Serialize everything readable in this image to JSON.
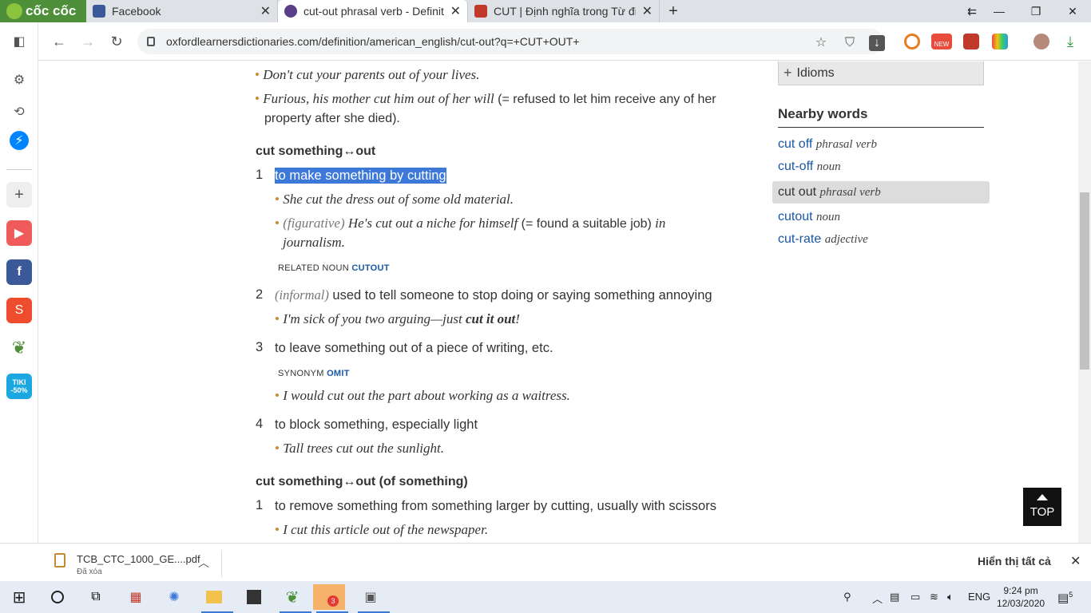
{
  "browser": {
    "logo_text": "cốc cốc",
    "tabs": [
      {
        "title": "Facebook",
        "icon": "facebook-icon",
        "color": "#3b5998"
      },
      {
        "title": "cut-out phrasal verb - Definiti",
        "icon": "oxford-icon",
        "color": "#1a2a6c",
        "active": true
      },
      {
        "title": "CUT | Định nghĩa trong Từ điể",
        "icon": "cambridge-icon",
        "color": "#c0392b"
      }
    ],
    "new_tab": "+",
    "url": "oxfordlearnersdictionaries.com/definition/american_english/cut-out?q=+CUT+OUT+"
  },
  "sidebar": {
    "items": [
      "sidebar-toggle-icon",
      "settings-icon",
      "history-icon",
      "messenger-icon",
      "add-icon",
      "youtube-icon",
      "facebook-icon",
      "shopee-icon",
      "coccoc-icon",
      "tiki-icon"
    ],
    "tiki_text": "TIKI -50%"
  },
  "content": {
    "examples_top": [
      {
        "text": "Don't cut your parents out of your lives."
      },
      {
        "text_italic": "Furious, his mother cut him out of her will",
        "gloss": " (= refused to let him receive any of her",
        "gloss2": "property after she died)."
      }
    ],
    "phrase1": "cut something↔out",
    "sense1_num": "1",
    "sense1_text": "to make something by cutting",
    "sense1_ex1": "She cut the dress out of some old material.",
    "sense1_ex2_label": "(figurative)",
    "sense1_ex2_a": " He's cut out a niche for himself",
    "sense1_ex2_gloss": " (= found a suitable job)",
    "sense1_ex2_b": " in",
    "sense1_ex2_c": "journalism.",
    "related_label": "RELATED NOUN",
    "related_link": "CUTOUT",
    "sense2_num": "2",
    "sense2_label": "(informal)",
    "sense2_text": " used to tell someone to stop doing or saying something annoying",
    "sense2_ex_a": "I'm sick of you two arguing—just ",
    "sense2_ex_b": "cut it out",
    "sense2_ex_c": "!",
    "sense3_num": "3",
    "sense3_text": "to leave something out of a piece of writing, etc.",
    "synonym_label": "SYNONYM",
    "synonym_link": "OMIT",
    "sense3_ex": "I would cut out the part about working as a waitress.",
    "sense4_num": "4",
    "sense4_text": "to block something, especially light",
    "sense4_ex": "Tall trees cut out the sunlight.",
    "phrase2": "cut something↔out (of something)",
    "sense5_num": "1",
    "sense5_text": "to remove something from something larger by cutting, usually with scissors",
    "sense5_ex": "I cut this article out of the newspaper."
  },
  "right": {
    "idioms": "Idioms",
    "nearby_title": "Nearby words",
    "nearby": [
      {
        "word": "cut off",
        "pos": "phrasal verb"
      },
      {
        "word": "cut-off",
        "pos": "noun"
      },
      {
        "word": "cut out",
        "pos": "phrasal verb",
        "active": true
      },
      {
        "word": "cutout",
        "pos": "noun"
      },
      {
        "word": "cut-rate",
        "pos": "adjective"
      }
    ],
    "top_button": "TOP"
  },
  "downloads": {
    "filename": "TCB_CTC_1000_GE....pdf",
    "status": "Đã xóa",
    "show_all": "Hiển thị tất cả"
  },
  "taskbar": {
    "zalo_badge": "3",
    "lang": "ENG",
    "time": "9:24 pm",
    "date": "12/03/2020",
    "notifications": "5"
  },
  "colors": {
    "link": "#1a57a6",
    "highlight": "#3b78d8",
    "bullet": "#c58a33"
  }
}
